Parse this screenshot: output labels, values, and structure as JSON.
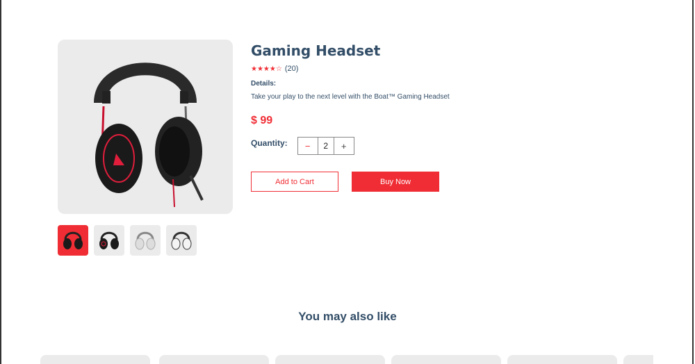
{
  "product": {
    "title": "Gaming Headset",
    "stars": "★★★★☆",
    "review_count": "(20)",
    "details_label": "Details:",
    "details_text": "Take your play to the next level with the Boat™ Gaming Headset",
    "price": "$ 99"
  },
  "quantity": {
    "label": "Quantity:",
    "minus": "−",
    "value": "2",
    "plus": "+"
  },
  "buttons": {
    "add_to_cart": "Add to Cart",
    "buy_now": "Buy Now"
  },
  "related": {
    "title": "You may also like"
  },
  "colors": {
    "accent": "#f02d34",
    "text": "#324d67",
    "image_bg": "#ebebeb"
  }
}
